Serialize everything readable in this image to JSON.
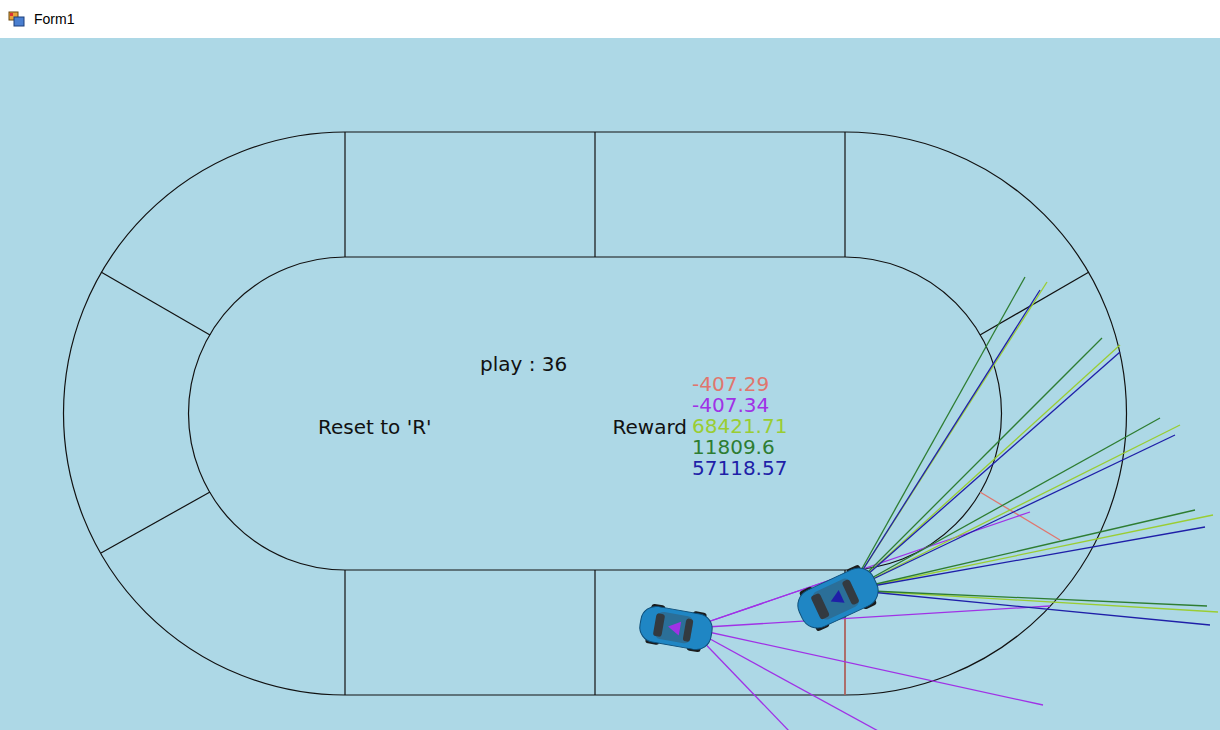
{
  "window": {
    "title": "Form1"
  },
  "hud": {
    "play": "play : 36",
    "reset": "Reset to 'R'",
    "reward_label": "Reward"
  },
  "rewards": [
    {
      "value": "-407.29",
      "color": "#e0766e"
    },
    {
      "value": "-407.34",
      "color": "#a032e6"
    },
    {
      "value": "68421.71",
      "color": "#9acd32"
    },
    {
      "value": "11809.6",
      "color": "#2e7d32"
    },
    {
      "value": "57118.57",
      "color": "#1f1fa8"
    }
  ]
}
